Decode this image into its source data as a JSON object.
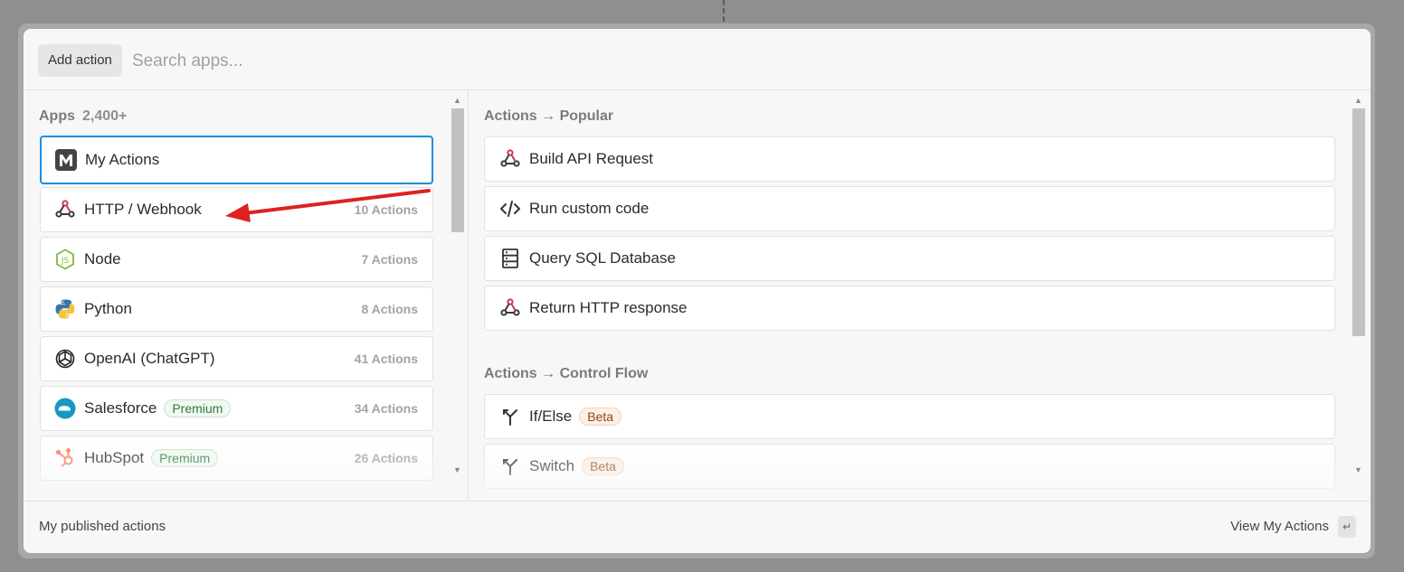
{
  "header": {
    "add_action_label": "Add action",
    "search_placeholder": "Search apps..."
  },
  "apps": {
    "title": "Apps",
    "count": "2,400+",
    "items": [
      {
        "name": "My Actions",
        "icon": "my-actions-icon",
        "actions": "",
        "badge": "",
        "selected": true
      },
      {
        "name": "HTTP / Webhook",
        "icon": "webhook-icon",
        "actions": "10 Actions",
        "badge": ""
      },
      {
        "name": "Node",
        "icon": "nodejs-icon",
        "actions": "7 Actions",
        "badge": ""
      },
      {
        "name": "Python",
        "icon": "python-icon",
        "actions": "8 Actions",
        "badge": ""
      },
      {
        "name": "OpenAI (ChatGPT)",
        "icon": "openai-icon",
        "actions": "41 Actions",
        "badge": ""
      },
      {
        "name": "Salesforce",
        "icon": "salesforce-icon",
        "actions": "34 Actions",
        "badge": "Premium"
      },
      {
        "name": "HubSpot",
        "icon": "hubspot-icon",
        "actions": "26 Actions",
        "badge": "Premium"
      }
    ]
  },
  "actions": {
    "popular": {
      "title": "Actions → Popular",
      "items": [
        {
          "name": "Build API Request",
          "icon": "webhook-icon"
        },
        {
          "name": "Run custom code",
          "icon": "code-icon"
        },
        {
          "name": "Query SQL Database",
          "icon": "database-icon"
        },
        {
          "name": "Return HTTP response",
          "icon": "webhook-icon"
        }
      ]
    },
    "control_flow": {
      "title": "Actions → Control Flow",
      "items": [
        {
          "name": "If/Else",
          "icon": "branch-icon",
          "badge": "Beta"
        },
        {
          "name": "Switch",
          "icon": "branch-icon",
          "badge": "Beta"
        }
      ]
    }
  },
  "footer": {
    "left_label": "My published actions",
    "right_label": "View My Actions",
    "enter_key": "↵"
  },
  "colors": {
    "selected_border": "#1a8fe3",
    "annotation_arrow": "#e02020",
    "webhook_accent": "#c73a4f"
  }
}
